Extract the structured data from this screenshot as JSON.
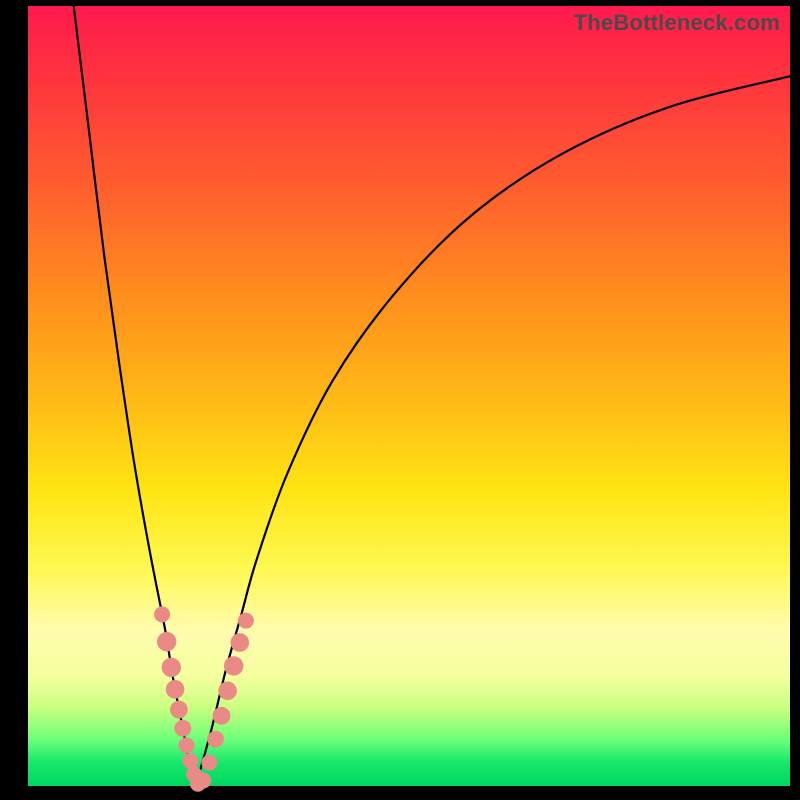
{
  "watermark": {
    "text": "TheBottleneck.com"
  },
  "colors": {
    "frame": "#000000",
    "bead": "#e98a86",
    "curve": "#000000",
    "gradient_top": "#ff1a4d",
    "gradient_bottom": "#00d762"
  },
  "chart_data": {
    "type": "line",
    "title": "",
    "xlabel": "",
    "ylabel": "",
    "xlim": [
      0,
      100
    ],
    "ylim": [
      0,
      100
    ],
    "notes": "V-shaped bottleneck curve. y is mismatch percentage (0 = optimal, green band; 100 = worst, red). x is relative component capability. Minimum at x≈22.",
    "series": [
      {
        "name": "left-branch",
        "x": [
          6,
          8,
          10,
          12,
          14,
          16,
          18,
          19,
          20,
          21,
          22
        ],
        "values": [
          100,
          84,
          68,
          54,
          41,
          30,
          20,
          14,
          9,
          4,
          0
        ]
      },
      {
        "name": "right-branch",
        "x": [
          22,
          24,
          26,
          28,
          30,
          34,
          40,
          48,
          58,
          70,
          84,
          100
        ],
        "values": [
          0,
          7,
          15,
          22,
          29,
          40,
          52,
          63,
          73,
          81,
          87,
          91
        ]
      }
    ],
    "beads": {
      "comment": "salmon-colored marker dots clustered near the trough of the V",
      "points": [
        {
          "x": 17.6,
          "y": 22,
          "r": 1.2
        },
        {
          "x": 18.2,
          "y": 18.5,
          "r": 1.6
        },
        {
          "x": 18.8,
          "y": 15.2,
          "r": 1.6
        },
        {
          "x": 19.3,
          "y": 12.4,
          "r": 1.5
        },
        {
          "x": 19.8,
          "y": 9.8,
          "r": 1.4
        },
        {
          "x": 20.3,
          "y": 7.4,
          "r": 1.3
        },
        {
          "x": 20.8,
          "y": 5.2,
          "r": 1.2
        },
        {
          "x": 21.3,
          "y": 3.2,
          "r": 1.2
        },
        {
          "x": 21.8,
          "y": 1.5,
          "r": 1.2
        },
        {
          "x": 22.3,
          "y": 0.3,
          "r": 1.2
        },
        {
          "x": 23.0,
          "y": 0.7,
          "r": 1.2
        },
        {
          "x": 23.8,
          "y": 3.0,
          "r": 1.2
        },
        {
          "x": 24.6,
          "y": 6.0,
          "r": 1.3
        },
        {
          "x": 25.4,
          "y": 9.0,
          "r": 1.4
        },
        {
          "x": 26.2,
          "y": 12.2,
          "r": 1.5
        },
        {
          "x": 27.0,
          "y": 15.4,
          "r": 1.6
        },
        {
          "x": 27.8,
          "y": 18.4,
          "r": 1.5
        },
        {
          "x": 28.6,
          "y": 21.2,
          "r": 1.2
        }
      ]
    }
  }
}
